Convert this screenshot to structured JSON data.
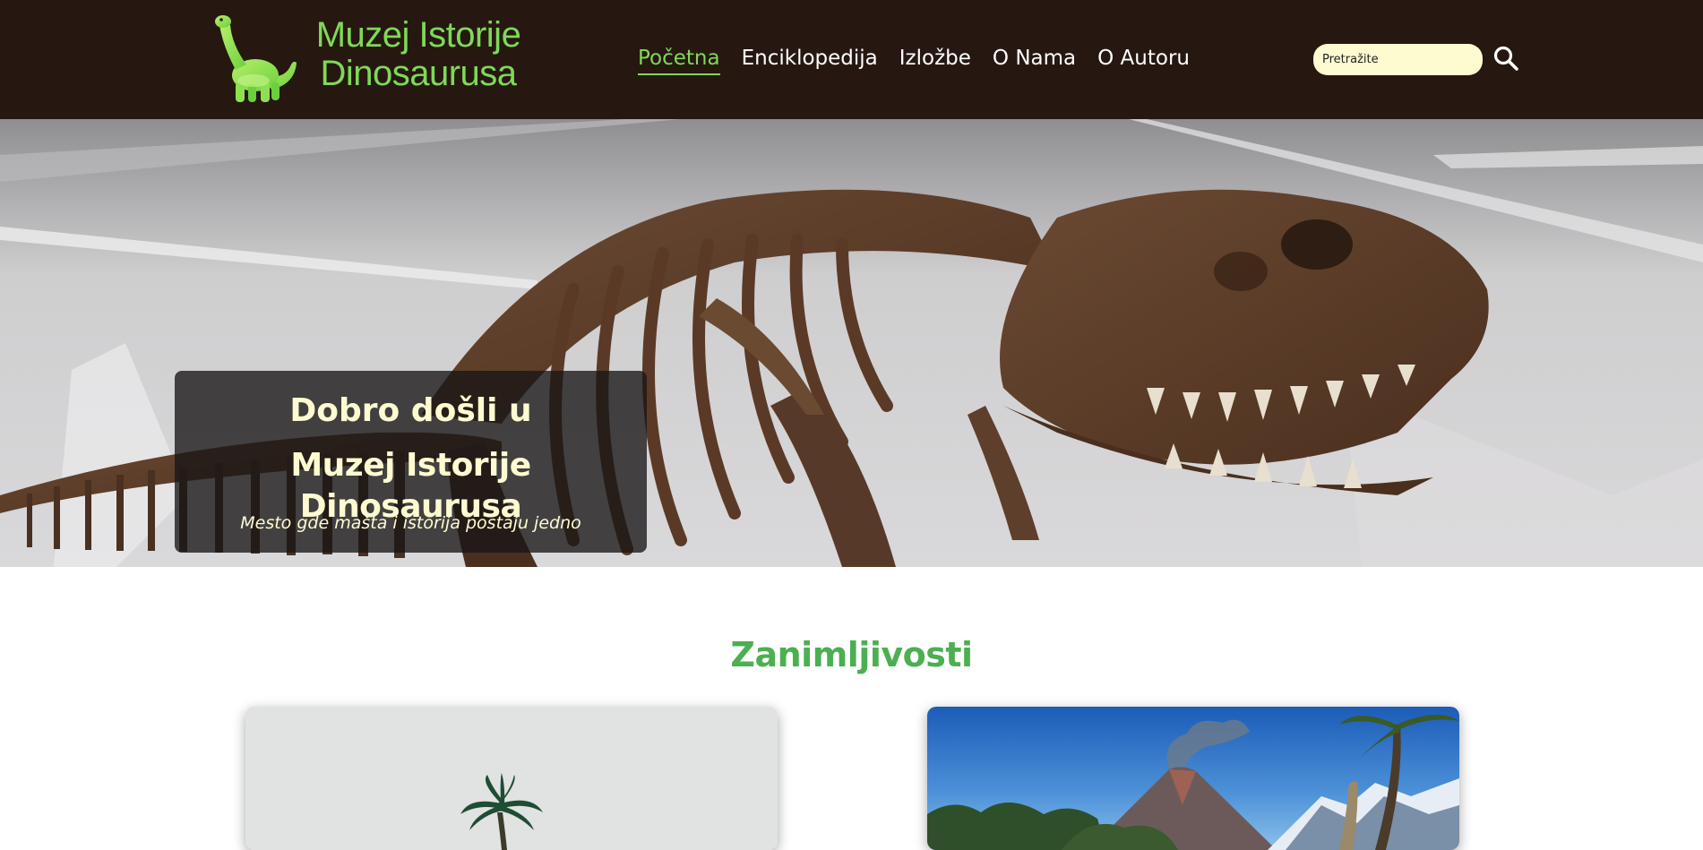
{
  "colors": {
    "header_bg": "#261811",
    "accent_green": "#7ed957",
    "section_green": "#4caf50",
    "cream": "#fffbd1"
  },
  "logo": {
    "line1": "Muzej Istorije",
    "line2": "Dinosaurusa",
    "icon": "dinosaur-icon"
  },
  "nav": {
    "items": [
      {
        "label": "Početna",
        "active": true
      },
      {
        "label": "Enciklopedija"
      },
      {
        "label": "Izložbe"
      },
      {
        "label": "O Nama"
      },
      {
        "label": "O Autoru"
      }
    ]
  },
  "search": {
    "placeholder": "Pretražite",
    "icon": "search-icon"
  },
  "hero": {
    "title_line1": "Dobro došli u",
    "title_line2": "Muzej Istorije Dinosaurusa",
    "subtitle": "Mesto gde mašta i istorija postaju jedno"
  },
  "section": {
    "title": "Zanimljivosti"
  }
}
